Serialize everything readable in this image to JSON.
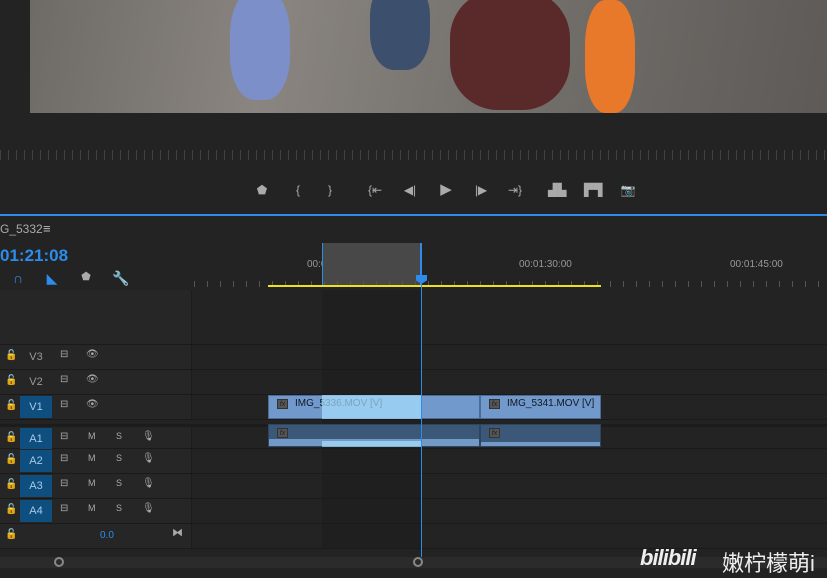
{
  "monitor": {
    "transport": [
      {
        "icon": "marker-icon",
        "glyph": "⬟"
      },
      {
        "icon": "mark-in-icon",
        "glyph": "{"
      },
      {
        "icon": "mark-out-icon",
        "glyph": "}"
      },
      {
        "icon": "go-to-in-icon",
        "glyph": "{⇤"
      },
      {
        "icon": "step-back-icon",
        "glyph": "◀|"
      },
      {
        "icon": "play-icon",
        "glyph": "▶"
      },
      {
        "icon": "step-forward-icon",
        "glyph": "|▶"
      },
      {
        "icon": "go-to-out-icon",
        "glyph": "⇥}"
      },
      {
        "icon": "lift-icon",
        "glyph": "▟▙"
      },
      {
        "icon": "extract-icon",
        "glyph": "▛▜"
      },
      {
        "icon": "export-frame-icon",
        "glyph": "📷"
      }
    ]
  },
  "timeline": {
    "sequence_name": "G_5332",
    "menu_glyph": "≡",
    "timecode": "01:21:08",
    "ruler_labels": [
      "00:01:15:00",
      "00:01:30:00",
      "00:01:45:00"
    ],
    "tracks": [
      {
        "name": "V3",
        "type": "video",
        "targeted": false
      },
      {
        "name": "V2",
        "type": "video",
        "targeted": false
      },
      {
        "name": "V1",
        "type": "video",
        "targeted": true
      },
      {
        "name": "A1",
        "type": "audio",
        "targeted": true
      },
      {
        "name": "A2",
        "type": "audio",
        "targeted": true
      },
      {
        "name": "A3",
        "type": "audio",
        "targeted": true
      },
      {
        "name": "A4",
        "type": "audio",
        "targeted": true
      }
    ],
    "audio_buttons": {
      "mute": "M",
      "solo": "S"
    },
    "master_volume": "0.0",
    "clips": [
      {
        "name": "IMG_5336.MOV [V]"
      },
      {
        "name": "IMG_5341.MOV [V]"
      }
    ],
    "fx_label": "fx"
  },
  "watermark": {
    "logo": "bilibili",
    "text": "嫩柠檬萌i"
  },
  "colors": {
    "accent": "#2d8ceb",
    "work_area": "#f0e020",
    "clip_video": "#7199cc",
    "track_target": "#0e4f80"
  }
}
